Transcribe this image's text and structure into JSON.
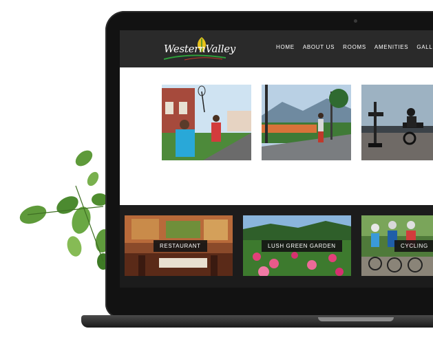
{
  "site": {
    "logo_text": "WesternValley"
  },
  "nav": {
    "items": [
      "HOME",
      "ABOUT US",
      "ROOMS",
      "AMENITIES",
      "GALLERY"
    ]
  },
  "gallery_top": {
    "photos": [
      "badminton",
      "walking-path",
      "gym"
    ]
  },
  "amenities": {
    "cards": [
      {
        "label": "RESTAURANT"
      },
      {
        "label": "LUSH GREEN GARDEN"
      },
      {
        "label": "CYCLING"
      }
    ]
  },
  "colors": {
    "header_bg": "#2a2a2a",
    "band_bg": "#1c1c1c",
    "laptop_frame": "#121212",
    "logo_leaf": "#e8c21a",
    "logo_swoosh": "#2e9e3a"
  }
}
